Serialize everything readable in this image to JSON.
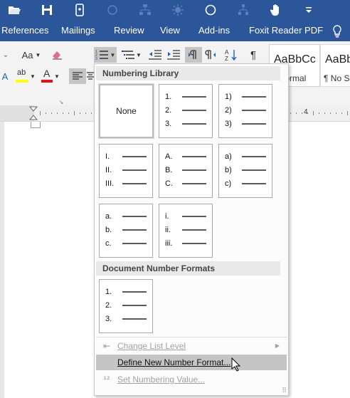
{
  "quick_access": {
    "icons": [
      "folder-open-icon",
      "save-icon",
      "touch-mode-icon",
      "circle-icon",
      "org-chart-icon",
      "brightness-icon",
      "circle-outline-icon",
      "hierarchy-icon",
      "hand-icon",
      "customize-qat-icon"
    ]
  },
  "tabs": [
    "References",
    "Mailings",
    "Review",
    "View",
    "Add-ins",
    "Foxit Reader PDF"
  ],
  "tell_me_icon": "lightbulb-icon",
  "ribbon": {
    "font_size_label": "Aa",
    "style_gallery": [
      {
        "preview": "AaBbCc",
        "name": "Normal",
        "name_shown": "Iormal"
      },
      {
        "preview": "AaBb",
        "name": "¶ No Sp"
      }
    ]
  },
  "ruler": {
    "number": "4"
  },
  "menu": {
    "numbering_library_header": "Numbering Library",
    "none_label": "None",
    "library": [
      [
        {
          "type": "none"
        },
        {
          "markers": [
            "1.",
            "2.",
            "3."
          ]
        },
        {
          "markers": [
            "1)",
            "2)",
            "3)"
          ]
        }
      ],
      [
        {
          "markers": [
            "I.",
            "II.",
            "III."
          ]
        },
        {
          "markers": [
            "A.",
            "B.",
            "C."
          ]
        },
        {
          "markers": [
            "a)",
            "b)",
            "c)"
          ]
        }
      ],
      [
        {
          "markers": [
            "a.",
            "b.",
            "c."
          ]
        },
        {
          "markers": [
            "i.",
            "ii.",
            "iii."
          ]
        }
      ]
    ],
    "document_formats_header": "Document Number Formats",
    "document_formats": [
      {
        "markers": [
          "1.",
          "2.",
          "3."
        ]
      }
    ],
    "items": [
      {
        "label": "Change List Level",
        "enabled": false,
        "submenu": true
      },
      {
        "label": "Define New Number Format...",
        "enabled": true,
        "highlighted": true
      },
      {
        "label": "Set Numbering Value...",
        "enabled": false
      }
    ]
  },
  "colors": {
    "titlebar": "#2b579a",
    "ribbon_bg": "#f3f3f3",
    "highlight_yellow": "#ffff00",
    "font_color_red": "#e8111b",
    "menu_hover": "#c5c5c5",
    "disabled_text": "#a0a0a0"
  }
}
